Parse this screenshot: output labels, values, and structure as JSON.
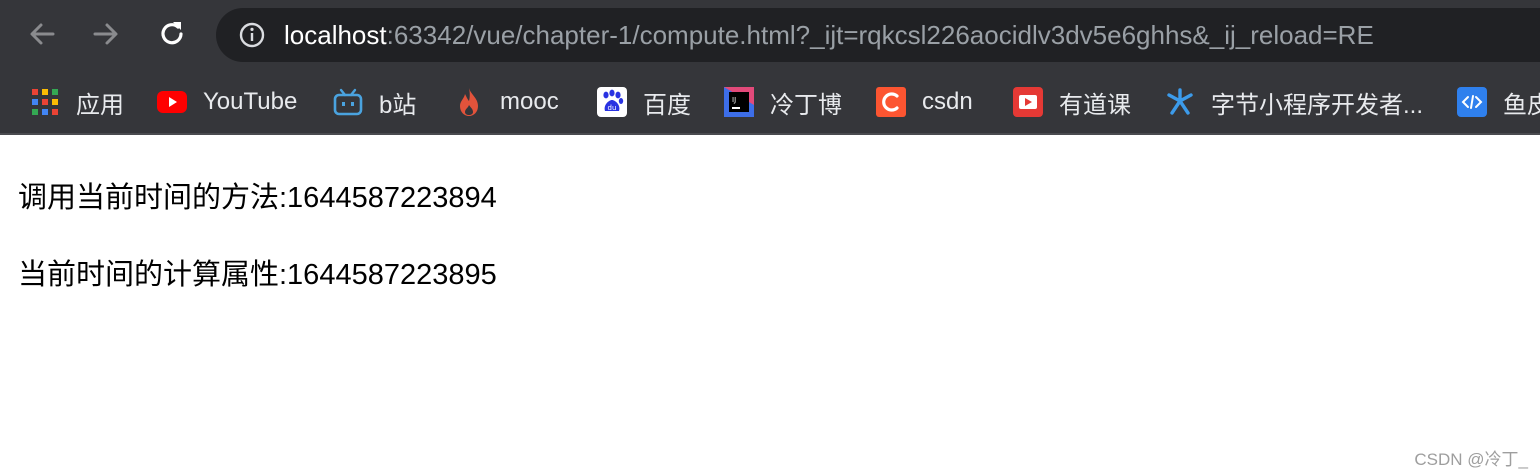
{
  "browser": {
    "url_host": "localhost",
    "url_rest": ":63342/vue/chapter-1/compute.html?_ijt=rqkcsl226aocidlv3dv5e6ghhs&_ij_reload=RE",
    "bookmarks": [
      {
        "label": "应用",
        "icon": "apps-grid-icon"
      },
      {
        "label": "YouTube",
        "icon": "youtube-icon"
      },
      {
        "label": "b站",
        "icon": "bilibili-icon"
      },
      {
        "label": "mooc",
        "icon": "flame-icon"
      },
      {
        "label": "百度",
        "icon": "baidu-paw-icon"
      },
      {
        "label": "冷丁博",
        "icon": "jetbrains-icon"
      },
      {
        "label": "csdn",
        "icon": "csdn-icon"
      },
      {
        "label": "有道课",
        "icon": "youdao-icon"
      },
      {
        "label": "字节小程序开发者...",
        "icon": "bytedance-icon"
      },
      {
        "label": "鱼皮",
        "icon": "code-icon"
      }
    ]
  },
  "content": {
    "method_line": "调用当前时间的方法:1644587223894",
    "computed_line": "当前时间的计算属性:1644587223895"
  },
  "watermark": "CSDN @冷丁_"
}
